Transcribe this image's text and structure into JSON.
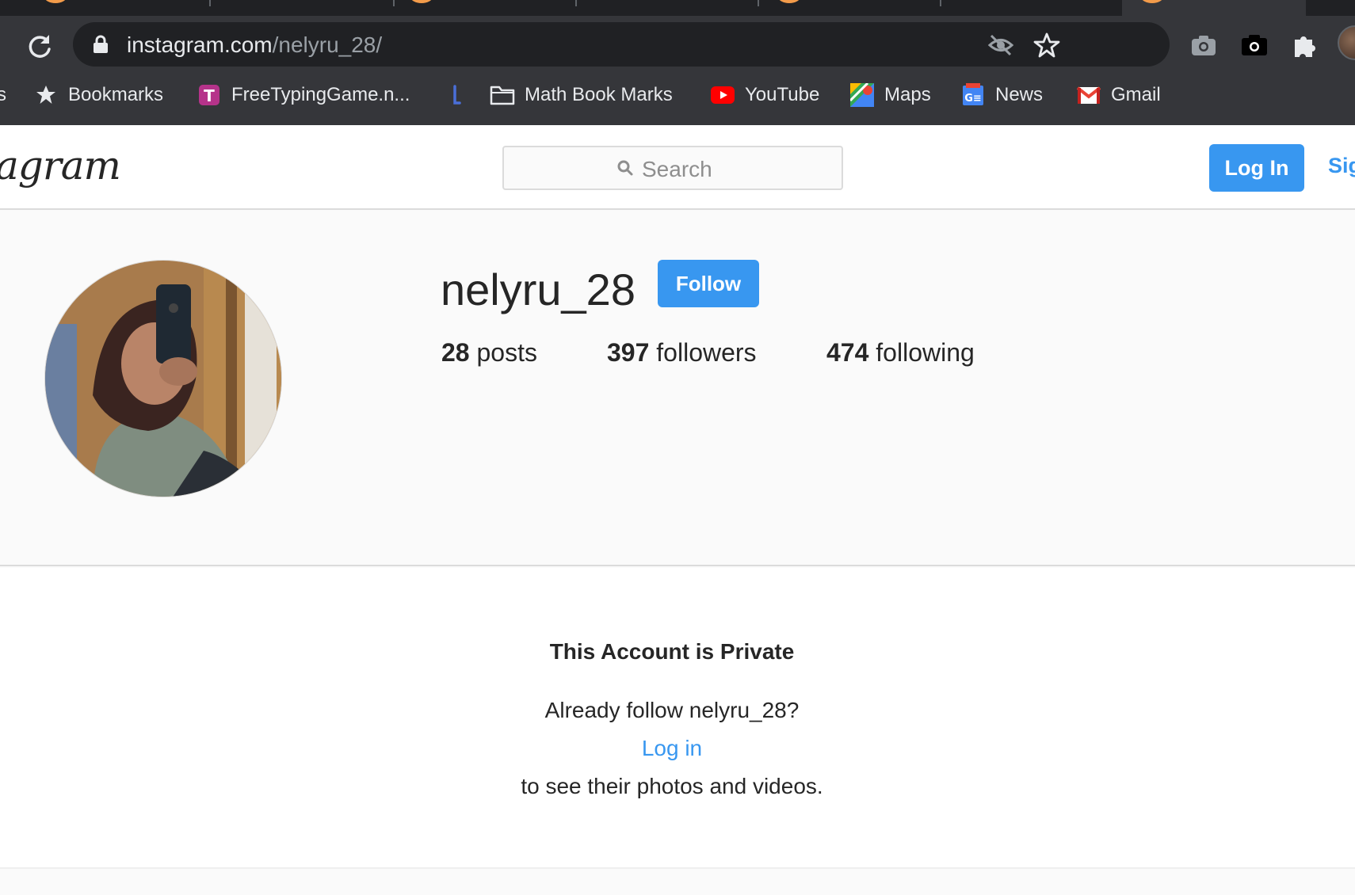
{
  "browser": {
    "url_domain": "instagram.com",
    "url_path": "/nelyru_28/",
    "bookmarks": [
      {
        "label": "s",
        "icon": "truncated"
      },
      {
        "label": "Bookmarks",
        "icon": "star-icon"
      },
      {
        "label": "FreeTypingGame.n...",
        "icon": "t-favicon"
      },
      {
        "label": "",
        "icon": "bracket-favicon"
      },
      {
        "label": "Math Book Marks",
        "icon": "folder-icon"
      },
      {
        "label": "YouTube",
        "icon": "youtube-icon"
      },
      {
        "label": "Maps",
        "icon": "maps-icon"
      },
      {
        "label": "News",
        "icon": "news-icon"
      },
      {
        "label": "Gmail",
        "icon": "gmail-icon"
      }
    ]
  },
  "header": {
    "logo": "agram",
    "search_placeholder": "Search",
    "login_label": "Log In",
    "signup_label": "Sig"
  },
  "profile": {
    "username": "nelyru_28",
    "follow_label": "Follow",
    "posts_count": "28",
    "posts_label": "posts",
    "followers_count": "397",
    "followers_label": "followers",
    "following_count": "474",
    "following_label": "following"
  },
  "private": {
    "title": "This Account is Private",
    "already": "Already follow nelyru_28?",
    "login_link": "Log in",
    "suffix": "to see their photos and videos."
  },
  "colors": {
    "accent": "#3897f0",
    "chrome_bg": "#35363a",
    "omnibox_bg": "#202124"
  }
}
